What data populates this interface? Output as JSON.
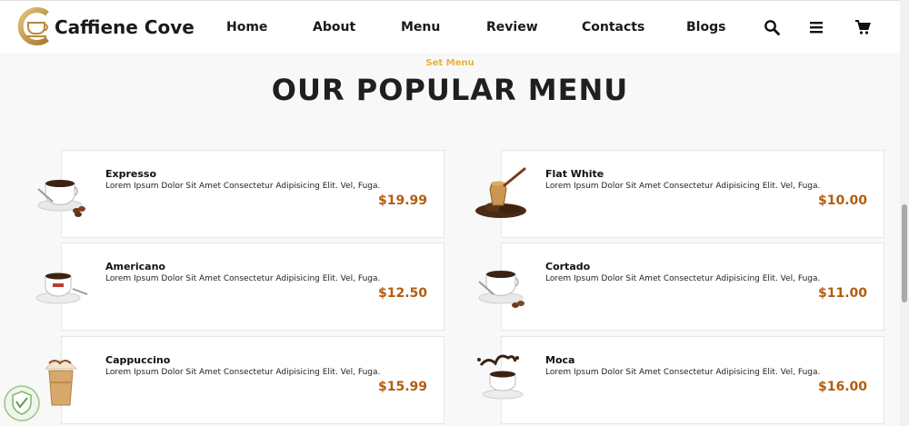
{
  "brand": {
    "name": "Caffiene Cove"
  },
  "nav": [
    {
      "label": "Home"
    },
    {
      "label": "About"
    },
    {
      "label": "Menu"
    },
    {
      "label": "Review"
    },
    {
      "label": "Contacts"
    },
    {
      "label": "Blogs"
    }
  ],
  "header_icons": [
    "search-icon",
    "menu-bars-icon",
    "cart-icon"
  ],
  "section": {
    "subtitle": "Set Menu",
    "title": "OUR POPULAR MENU"
  },
  "menu_items": [
    {
      "name": "Expresso",
      "desc": "Lorem Ipsum Dolor Sit Amet Consectetur Adipisicing Elit. Vel, Fuga.",
      "price": "$19.99",
      "image": "espresso-cup-image"
    },
    {
      "name": "Flat White",
      "desc": "Lorem Ipsum Dolor Sit Amet Consectetur Adipisicing Elit. Vel, Fuga.",
      "price": "$10.00",
      "image": "turkish-pot-beans-image"
    },
    {
      "name": "Americano",
      "desc": "Lorem Ipsum Dolor Sit Amet Consectetur Adipisicing Elit. Vel, Fuga.",
      "price": "$12.50",
      "image": "americano-cup-image"
    },
    {
      "name": "Cortado",
      "desc": "Lorem Ipsum Dolor Sit Amet Consectetur Adipisicing Elit. Vel, Fuga.",
      "price": "$11.00",
      "image": "cortado-cup-image"
    },
    {
      "name": "Cappuccino",
      "desc": "Lorem Ipsum Dolor Sit Amet Consectetur Adipisicing Elit. Vel, Fuga.",
      "price": "$15.99",
      "image": "cappuccino-glass-image"
    },
    {
      "name": "Moca",
      "desc": "Lorem Ipsum Dolor Sit Amet Consectetur Adipisicing Elit. Vel, Fuga.",
      "price": "$16.00",
      "image": "moca-splash-cup-image"
    }
  ],
  "colors": {
    "accent_gold": "#e8b238",
    "price": "#b35d0f",
    "logo_gold": "#c49a4a",
    "text_dark": "#1a1a1a"
  }
}
